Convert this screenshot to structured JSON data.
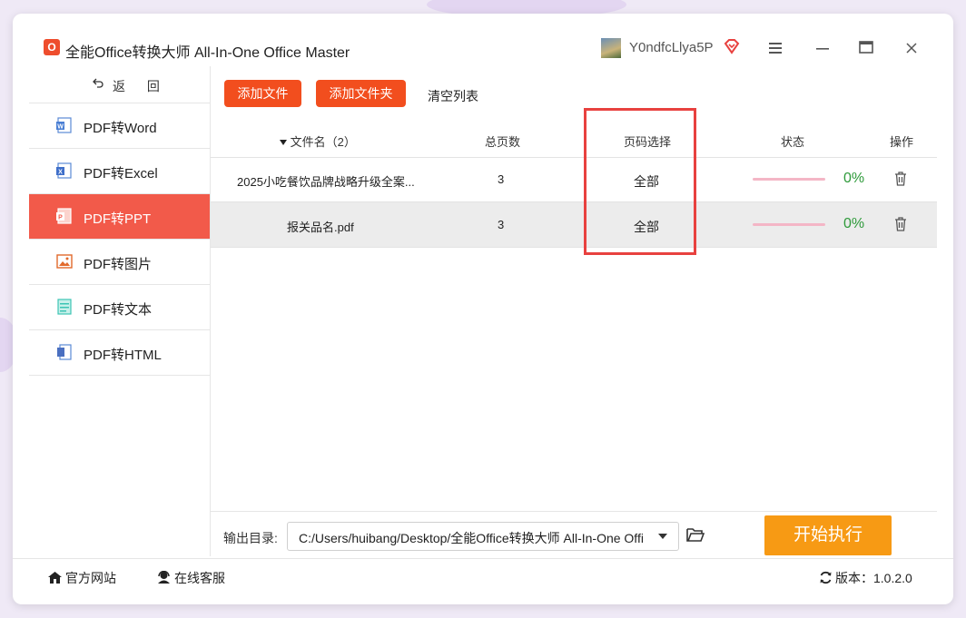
{
  "window": {
    "title": "全能Office转换大师 All-In-One Office Master",
    "logo_text": "O",
    "username": "Y0ndfcLlya5P"
  },
  "sidebar": {
    "back_label": "返 回",
    "items": [
      {
        "label": "PDF转Word",
        "icon": "word-doc-icon",
        "active": false
      },
      {
        "label": "PDF转Excel",
        "icon": "excel-doc-icon",
        "active": false
      },
      {
        "label": "PDF转PPT",
        "icon": "ppt-doc-icon",
        "active": true
      },
      {
        "label": "PDF转图片",
        "icon": "image-icon",
        "active": false
      },
      {
        "label": "PDF转文本",
        "icon": "text-doc-icon",
        "active": false
      },
      {
        "label": "PDF转HTML",
        "icon": "html-doc-icon",
        "active": false
      }
    ]
  },
  "toolbar": {
    "add_file": "添加文件",
    "add_folder": "添加文件夹",
    "clear_list": "清空列表"
  },
  "table": {
    "headers": {
      "filename": "文件名（2）",
      "pages": "总页数",
      "page_select": "页码选择",
      "status": "状态",
      "action": "操作"
    },
    "rows": [
      {
        "name": "2025小吃餐饮品牌战略升级全案...",
        "pages": "3",
        "range": "全部",
        "progress": "0%"
      },
      {
        "name": "报关品名.pdf",
        "pages": "3",
        "range": "全部",
        "progress": "0%"
      }
    ]
  },
  "output": {
    "label": "输出目录:",
    "path": "C:/Users/huibang/Desktop/全能Office转换大师 All-In-One Office Master",
    "start_button": "开始执行"
  },
  "footer": {
    "official_site": "官方网站",
    "online_service": "在线客服",
    "version": "版本：1.0.2.0"
  },
  "colors": {
    "accent_red": "#f24e1e",
    "active_nav": "#f25a4a",
    "start_orange": "#f79a14",
    "progress_green": "#2e9a3a",
    "highlight_border": "#e8413f"
  }
}
